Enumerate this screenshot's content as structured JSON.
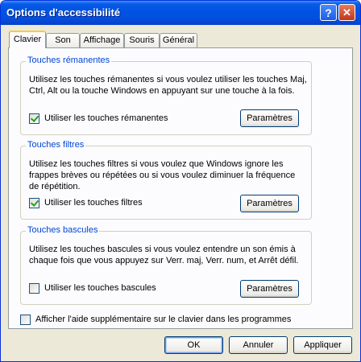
{
  "window": {
    "title": "Options d'accessibilité",
    "help_glyph": "?",
    "close_glyph": "✕"
  },
  "tabs": [
    {
      "label": "Clavier",
      "active": true
    },
    {
      "label": "Son"
    },
    {
      "label": "Affichage"
    },
    {
      "label": "Souris"
    },
    {
      "label": "Général"
    }
  ],
  "groups": {
    "sticky": {
      "title": "Touches rémanentes",
      "description": "Utilisez les touches rémanentes si vous voulez utiliser les touches Maj, Ctrl, Alt ou la touche Windows en appuyant sur une touche à la fois.",
      "checkbox_label": "Utiliser les touches rémanentes",
      "checked": true,
      "button_label": "Paramètres"
    },
    "filter": {
      "title": "Touches filtres",
      "description": "Utilisez les touches filtres si vous voulez que Windows ignore les frappes brèves ou répétées ou si vous voulez diminuer la fréquence de répétition.",
      "checkbox_label": "Utiliser les touches filtres",
      "checked": true,
      "button_label": "Paramètres"
    },
    "toggle": {
      "title": "Touches bascules",
      "description": "Utilisez les touches bascules si vous voulez entendre un son émis à chaque fois que vous appuyez sur Verr. maj, Verr. num, et Arrêt défil.",
      "checkbox_label": "Utiliser les touches bascules",
      "checked": false,
      "button_label": "Paramètres"
    }
  },
  "extra": {
    "label": "Afficher l'aide supplémentaire sur le clavier dans les programmes",
    "checked": false
  },
  "footer": {
    "ok_label": "OK",
    "cancel_label": "Annuler",
    "apply_label": "Appliquer"
  }
}
